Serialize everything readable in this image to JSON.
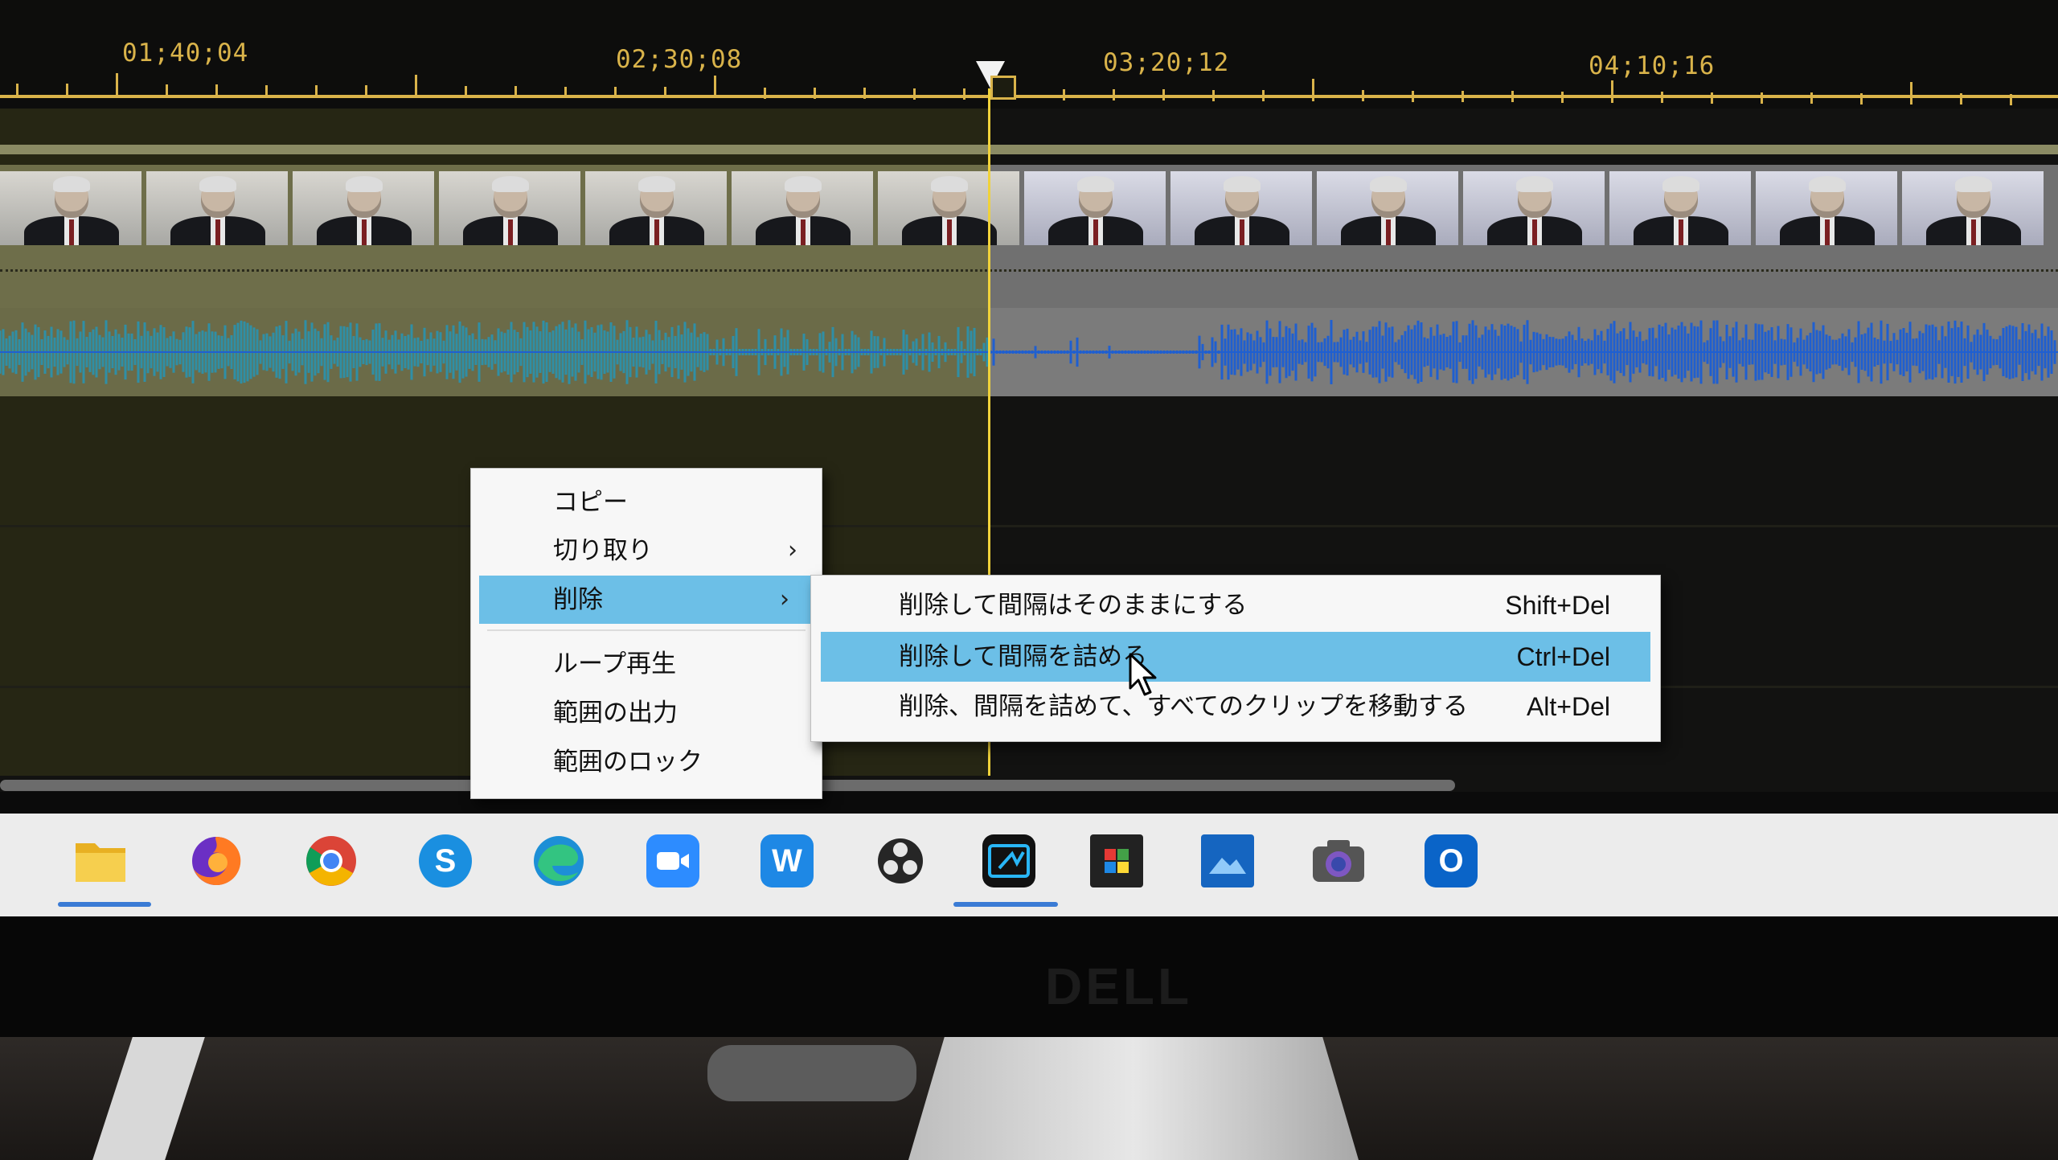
{
  "timeline": {
    "timecodes": [
      "01;40;04",
      "02;30;08",
      "03;20;12",
      "04;10;16"
    ]
  },
  "context_menu": {
    "items": [
      {
        "label": "コピー",
        "has_submenu": false
      },
      {
        "label": "切り取り",
        "has_submenu": true
      },
      {
        "label": "削除",
        "has_submenu": true,
        "highlighted": true
      },
      {
        "label": "ループ再生",
        "has_submenu": false
      },
      {
        "label": "範囲の出力",
        "has_submenu": false
      },
      {
        "label": "範囲のロック",
        "has_submenu": false
      }
    ],
    "submenu_arrow": "›"
  },
  "submenu": {
    "items": [
      {
        "label": "削除して間隔はそのままにする",
        "shortcut": "Shift+Del"
      },
      {
        "label": "削除して間隔を詰める",
        "shortcut": "Ctrl+Del",
        "highlighted": true
      },
      {
        "label": "削除、間隔を詰めて、すべてのクリップを移動する",
        "shortcut": "Alt+Del"
      }
    ]
  },
  "taskbar": {
    "icons": [
      "file-explorer-icon",
      "firefox-icon",
      "chrome-icon",
      "skype-icon",
      "edge-icon",
      "zoom-icon",
      "word-icon",
      "obs-icon",
      "video-editor-icon",
      "color-app-icon",
      "photos-video-icon",
      "camera-icon",
      "outlook-icon"
    ],
    "active_icon": "video-editor-icon"
  },
  "bezel": {
    "brand": "DELL"
  },
  "colors": {
    "timecode": "#d9b34a",
    "playhead": "#f0d23a",
    "menu_highlight": "#6cbfe7",
    "taskbar_active": "#3a7bd5"
  }
}
